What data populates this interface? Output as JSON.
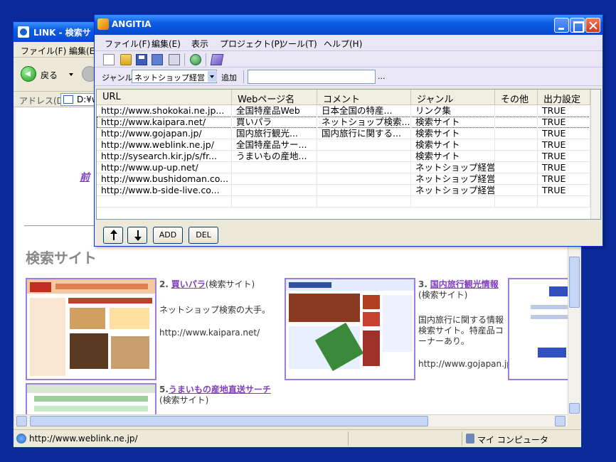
{
  "browser": {
    "title": "LINK - 検索サ",
    "menu": [
      "ファイル(F)",
      "編集(E"
    ],
    "back_label": "戻る",
    "address_label": "アドレス(D)",
    "address_value": "D:¥w",
    "content": {
      "prev_link": "前",
      "section_title": "検索サイト",
      "entries": [
        {
          "num": "2.",
          "name": "買いパラ",
          "tag": "(検索サイト)",
          "desc": "ネットショップ検索の大手。",
          "url": "http://www.kaipara.net/"
        },
        {
          "num": "3.",
          "name": "国内旅行観光情報",
          "tag": "(検索サイト)",
          "desc": "国内旅行に関する情報検索サイト。特産品コーナーあり。",
          "url": "http://www.gojapan.jp/"
        },
        {
          "num": "5.",
          "name": "うまいもの産地直送サーチ",
          "tag": "(検索サイト)"
        }
      ]
    },
    "status_text": "http://www.weblink.ne.jp/",
    "status_zone": "マイ コンピュータ"
  },
  "app": {
    "title": "ANGITIA",
    "menu": [
      "ファイル(F)",
      "編集(E)",
      "表示",
      "プロジェクト(P)",
      "ツール(T)",
      "ヘルプ(H)"
    ],
    "filter": {
      "genre_label": "ジャンル",
      "genre_value": "ネットショップ経営",
      "add_label": "追加",
      "add_input": "",
      "browse": "..."
    },
    "columns": [
      "URL",
      "Webページ名",
      "コメント",
      "ジャンル",
      "その他",
      "出力設定"
    ],
    "rows": [
      [
        "http://www.shokokai.ne.jp...",
        "全国特産品Web",
        "日本全国の特産...",
        "リンク集",
        "",
        "TRUE"
      ],
      [
        "http://www.kaipara.net/",
        "買いパラ",
        "ネットショップ検索...",
        "検索サイト",
        "",
        "TRUE"
      ],
      [
        "http://www.gojapan.jp/",
        "国内旅行観光...",
        "国内旅行に関する...",
        "検索サイト",
        "",
        "TRUE"
      ],
      [
        "http://www.weblink.ne.jp/",
        "全国特産品サー...",
        "",
        "検索サイト",
        "",
        "TRUE"
      ],
      [
        "http://sysearch.kir.jp/s/fr...",
        "うまいもの産地...",
        "",
        "検索サイト",
        "",
        "TRUE"
      ],
      [
        "http://www.up-up.net/",
        "",
        "",
        "ネットショップ経営",
        "",
        "TRUE"
      ],
      [
        "http://www.bushidoman.co...",
        "",
        "",
        "ネットショップ経営",
        "",
        "TRUE"
      ],
      [
        "http://www.b-side-live.co...",
        "",
        "",
        "ネットショップ経営",
        "",
        "TRUE"
      ]
    ],
    "buttons": {
      "add": "ADD",
      "del": "DEL"
    },
    "colors": {
      "titlebar": "#0a5de4",
      "menubar": "#e9e7f6"
    }
  }
}
